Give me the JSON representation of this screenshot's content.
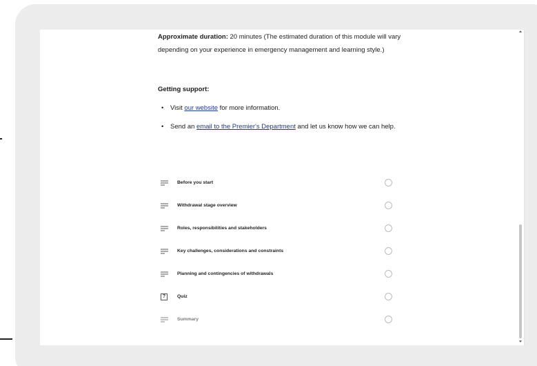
{
  "intro": {
    "duration_label": "Approximate duration:",
    "duration_text": " 20 minutes (The estimated duration of this module will vary depending on your experience in emergency management and learning style.)"
  },
  "support": {
    "heading": "Getting support:",
    "items": [
      {
        "pre": "Visit ",
        "link": "our website",
        "post": " for more information."
      },
      {
        "pre": "Send an ",
        "link": "email to the Premier's Department",
        "post": " and let us know how we can help."
      }
    ]
  },
  "lessons": [
    {
      "title": "Before you start",
      "icon": "text-lines-icon"
    },
    {
      "title": "Withdrawal stage overview",
      "icon": "text-lines-icon"
    },
    {
      "title": "Roles, responsibilities and stakeholders",
      "icon": "text-lines-icon"
    },
    {
      "title": "Key challenges, considerations and constraints",
      "icon": "text-lines-icon"
    },
    {
      "title": "Planning and contingencies of withdrawals",
      "icon": "text-lines-icon"
    },
    {
      "title": "Quiz",
      "icon": "quiz-icon",
      "icon_glyph": "?"
    },
    {
      "title": "Summary",
      "icon": "text-lines-icon"
    }
  ],
  "colors": {
    "link": "#1a3e8c",
    "frame": "#ececec"
  }
}
